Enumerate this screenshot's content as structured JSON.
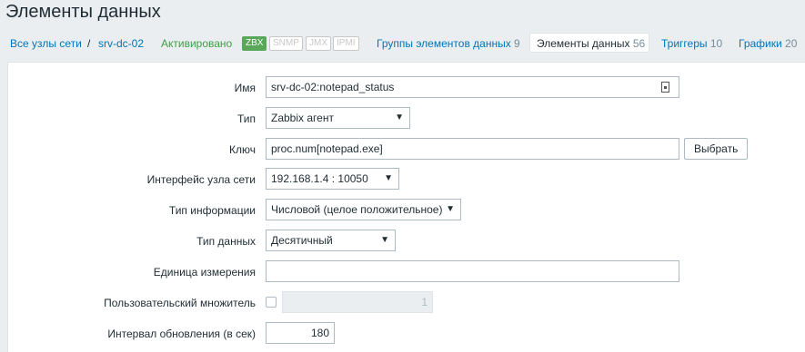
{
  "page": {
    "title": "Элементы данных"
  },
  "nav": {
    "all_hosts": "Все узлы сети",
    "separator": "/",
    "host": "srv-dc-02",
    "status": "Активировано",
    "availability": [
      "ZBX",
      "SNMP",
      "JMX",
      "IPMI"
    ],
    "item_groups_label": "Группы элементов данных",
    "item_groups_count": "9",
    "items_label": "Элементы данных",
    "items_count": "56",
    "triggers_label": "Триггеры",
    "triggers_count": "10",
    "graphs_label": "Графики",
    "graphs_count": "20"
  },
  "form": {
    "name_label": "Имя",
    "name_value": "srv-dc-02:notepad_status",
    "type_label": "Тип",
    "type_value": "Zabbix агент",
    "key_label": "Ключ",
    "key_value": "proc.num[notepad.exe]",
    "select_button": "Выбрать",
    "interface_label": "Интерфейс узла сети",
    "interface_value": "192.168.1.4 : 10050",
    "info_type_label": "Тип информации",
    "info_type_value": "Числовой (целое положительное)",
    "data_type_label": "Тип данных",
    "data_type_value": "Десятичный",
    "units_label": "Единица измерения",
    "units_value": "",
    "multiplier_label": "Пользовательский множитель",
    "multiplier_value": "1",
    "interval_label": "Интервал обновления (в сек)",
    "interval_value": "180"
  },
  "colors": {
    "link": "#0275b8",
    "enabled": "#429e47",
    "zbx_available": "#59a859"
  },
  "icons": {
    "dropdown": "triangle-down",
    "macro": "document-icon"
  }
}
